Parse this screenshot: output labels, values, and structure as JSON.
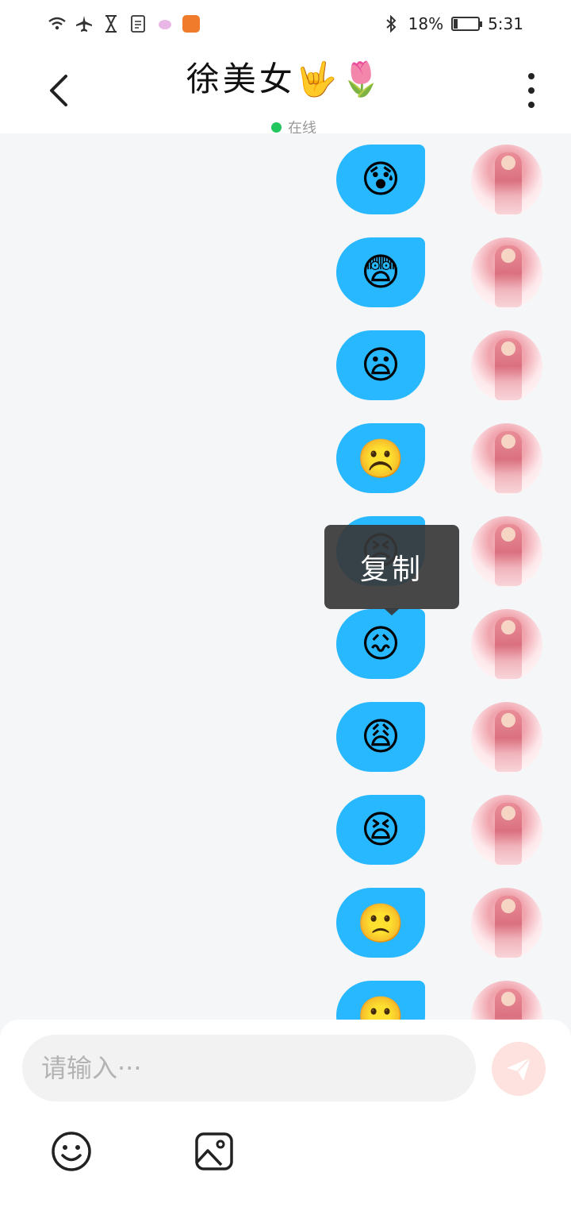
{
  "status_bar": {
    "battery_text": "18%",
    "battery_level": 0.18,
    "time": "5:31"
  },
  "header": {
    "title": "徐美女🤟🌷",
    "status_text": "在线"
  },
  "messages": [
    {
      "emoji": "😰"
    },
    {
      "emoji": "😨"
    },
    {
      "emoji": "😦"
    },
    {
      "emoji": "☹️"
    },
    {
      "emoji": "😣"
    },
    {
      "emoji": "😖"
    },
    {
      "emoji": "😩"
    },
    {
      "emoji": "😫"
    },
    {
      "emoji": "🙁"
    },
    {
      "emoji": "🙁"
    }
  ],
  "popup": {
    "copy_label": "复制"
  },
  "input": {
    "placeholder": "请输入···"
  },
  "colors": {
    "bubble": "#27b8ff",
    "online_dot": "#22c55e",
    "send_button": "#fde2df",
    "background": "#f4f6f8"
  },
  "icons": {
    "back": "chevron-left-icon",
    "more": "more-vertical-icon",
    "send": "paper-plane-icon",
    "emoji": "smiley-icon",
    "image": "image-icon"
  }
}
